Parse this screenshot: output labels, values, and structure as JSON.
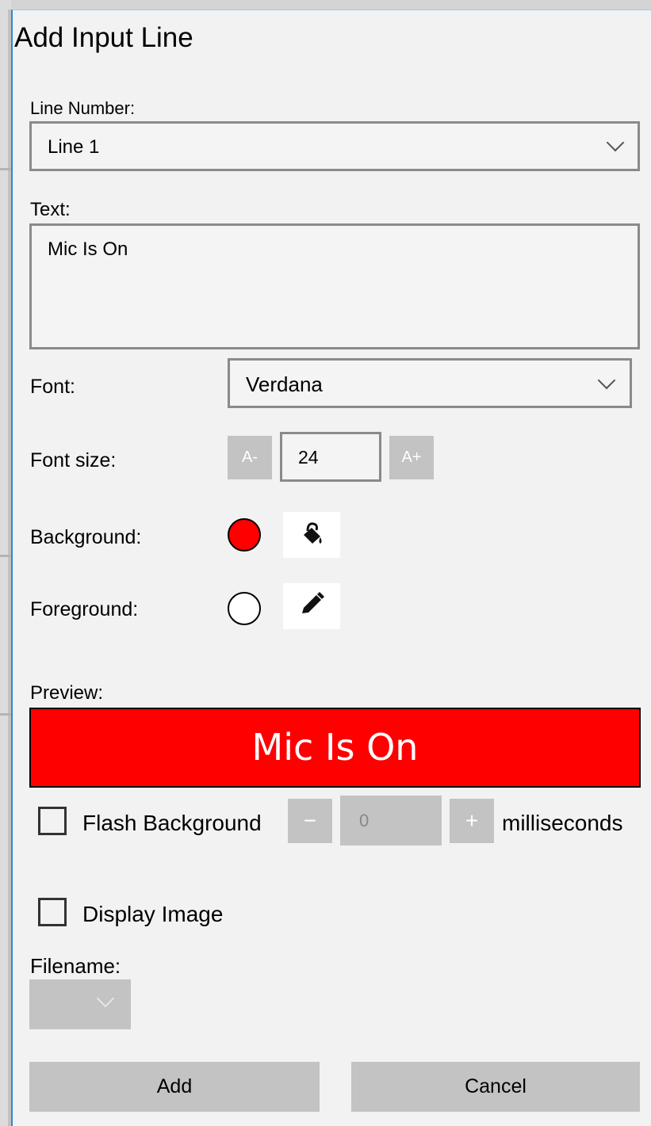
{
  "dialog": {
    "title": "Add Input Line"
  },
  "line_number": {
    "label": "Line Number:",
    "value": "Line 1"
  },
  "text": {
    "label": "Text:",
    "value": "Mic Is On"
  },
  "font": {
    "label": "Font:",
    "value": "Verdana"
  },
  "font_size": {
    "label": "Font size:",
    "decrease_label": "A-",
    "value": "24",
    "increase_label": "A+"
  },
  "background": {
    "label": "Background:",
    "color": "#ff0000",
    "picker_icon": "paint-bucket-icon"
  },
  "foreground": {
    "label": "Foreground:",
    "color": "#ffffff",
    "picker_icon": "pencil-icon"
  },
  "preview": {
    "label": "Preview:",
    "text": "Mic Is On",
    "background": "#ff0000",
    "foreground": "#ffffff"
  },
  "flash": {
    "label": "Flash Background",
    "checked": false,
    "minus_label": "−",
    "value": "0",
    "plus_label": "+",
    "unit": "milliseconds"
  },
  "display_image": {
    "label": "Display Image",
    "checked": false
  },
  "filename": {
    "label": "Filename:"
  },
  "actions": {
    "add_label": "Add",
    "cancel_label": "Cancel"
  }
}
